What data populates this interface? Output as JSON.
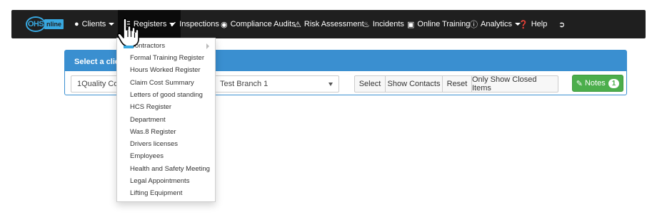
{
  "navbar": {
    "logo_main": "OHS",
    "logo_tag": "nline",
    "items": [
      {
        "label": "Clients",
        "icon": "user-icon",
        "has_caret": true
      },
      {
        "label": "Registers",
        "icon": "list-icon",
        "has_caret": true
      },
      {
        "label": "Inspections",
        "icon": "check-icon",
        "has_caret": false
      },
      {
        "label": "Compliance Audits",
        "icon": "eye-icon",
        "has_caret": false
      },
      {
        "label": "Risk Assessment",
        "icon": "warning-icon",
        "has_caret": false
      },
      {
        "label": "Incidents",
        "icon": "fire-icon",
        "has_caret": false
      },
      {
        "label": "Online Training",
        "icon": "book-icon",
        "has_caret": false
      },
      {
        "label": "Analytics",
        "icon": "info-icon",
        "has_caret": true
      },
      {
        "label": "Help",
        "icon": "question-icon",
        "has_caret": false
      }
    ],
    "logout_icon": "logout-icon"
  },
  "panel": {
    "heading": "Select a client",
    "client_select_value": "1Quality Com",
    "branch_select_value": "Test Branch 1",
    "buttons": {
      "select": "Select",
      "show_contacts": "Show Contacts",
      "reset": "Reset",
      "only_closed": "Only Show Closed Items"
    },
    "notes_label": "Notes",
    "notes_count": "1"
  },
  "registers_dropdown": {
    "items": [
      "Contractors",
      "Formal Training Register",
      "Hours Worked Register",
      "Claim Cost Summary",
      "Letters of good standing",
      "HCS Register",
      "Department",
      "Was.8 Register",
      "Drivers licenses",
      "Employees",
      "Health and Safety Meeting",
      "Legal Appointments",
      "Lifting Equipment"
    ]
  },
  "colors": {
    "navbar_bg": "#1f1f1f",
    "accent_blue": "#3a8fd0",
    "notes_green": "#4cae4c"
  }
}
